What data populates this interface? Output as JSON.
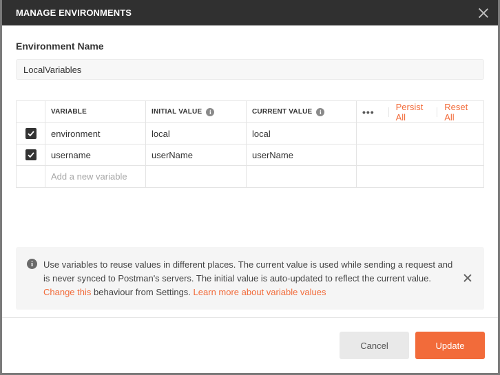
{
  "modal": {
    "title": "MANAGE ENVIRONMENTS"
  },
  "environment": {
    "name_label": "Environment Name",
    "name_value": "LocalVariables"
  },
  "table": {
    "headers": {
      "variable": "VARIABLE",
      "initial": "INITIAL VALUE",
      "current": "CURRENT VALUE"
    },
    "actions": {
      "more": "•••",
      "persist_all": "Persist All",
      "reset_all": "Reset All"
    },
    "rows": [
      {
        "checked": true,
        "variable": "environment",
        "initial": "local",
        "current": "local"
      },
      {
        "checked": true,
        "variable": "username",
        "initial": "userName",
        "current": "userName"
      }
    ],
    "new_row_placeholder": "Add a new variable"
  },
  "info": {
    "text": "Use variables to reuse values in different places. The current value is used while sending a request and is never synced to Postman's servers. The initial value is auto-updated to reflect the current value.",
    "change_link": "Change this",
    "after_change": " behaviour from Settings.",
    "learn_link": "Learn more about variable values"
  },
  "buttons": {
    "cancel": "Cancel",
    "update": "Update"
  },
  "colors": {
    "accent": "#f26b3a",
    "header_bg": "#303030"
  },
  "icons": {
    "close": "close-icon",
    "info": "info-icon",
    "check": "checkmark-icon"
  }
}
